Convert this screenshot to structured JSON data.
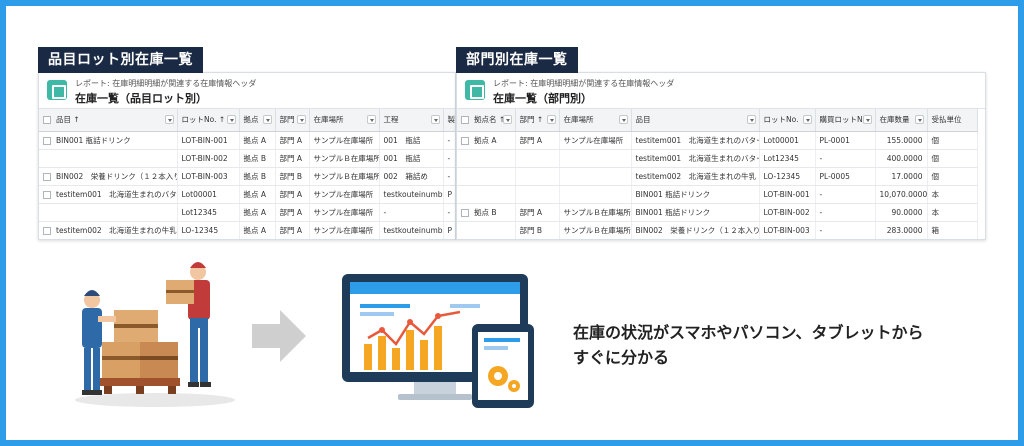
{
  "left_panel": {
    "tag": "品目ロット別在庫一覧",
    "report_subtitle": "レポート: 在庫明細明細が関連する在庫情報ヘッダ",
    "report_title": "在庫一覧（品目ロット別）",
    "columns": [
      "品目 ↑",
      "ロットNo. ↑",
      "拠点",
      "部門",
      "在庫場所",
      "工程",
      "製"
    ],
    "rows": [
      {
        "item": "BIN001 瓶詰ドリンク",
        "lot": "LOT-BIN-001",
        "site": "拠点 A",
        "dept": "部門 A",
        "loc": "サンプル在庫場所",
        "proc": "001　瓶詰",
        "x": "-"
      },
      {
        "item": "",
        "lot": "LOT-BIN-002",
        "site": "拠点 B",
        "dept": "部門 A",
        "loc": "サンプルＢ在庫場所",
        "proc": "001　瓶詰",
        "x": "-"
      },
      {
        "item": "BIN002　栄養ドリンク（１２本入り）",
        "lot": "LOT-BIN-003",
        "site": "拠点 B",
        "dept": "部門 B",
        "loc": "サンプルＢ在庫場所",
        "proc": "002　箱詰め",
        "x": "-"
      },
      {
        "item": "testitem001　北海道生まれのバター",
        "lot": "Lot00001",
        "site": "拠点 A",
        "dept": "部門 A",
        "loc": "サンプル在庫場所",
        "proc": "testkouteinumber",
        "x": "P"
      },
      {
        "item": "",
        "lot": "Lot12345",
        "site": "拠点 A",
        "dept": "部門 A",
        "loc": "サンプル在庫場所",
        "proc": "-",
        "x": "-"
      },
      {
        "item": "testitem002　北海道生まれの牛乳",
        "lot": "LO-12345",
        "site": "拠点 A",
        "dept": "部門 A",
        "loc": "サンプル在庫場所",
        "proc": "testkouteinumber",
        "x": "P"
      }
    ]
  },
  "right_panel": {
    "tag": "部門別在庫一覧",
    "report_subtitle": "レポート: 在庫明細明細が関連する在庫情報ヘッダ",
    "report_title": "在庫一覧（部門別）",
    "columns": [
      "拠点名 ↑",
      "部門 ↑",
      "在庫場所",
      "品目",
      "ロットNo.",
      "購買ロットNo.",
      "在庫数量",
      "受払単位"
    ],
    "rows": [
      {
        "site": "拠点 A",
        "dept": "部門 A",
        "loc": "サンプル在庫場所",
        "item": "testitem001　北海道生まれのバター",
        "lot": "Lot00001",
        "plot": "PL-0001",
        "qty": "155.0000",
        "unit": "個"
      },
      {
        "site": "",
        "dept": "",
        "loc": "",
        "item": "testitem001　北海道生まれのバター",
        "lot": "Lot12345",
        "plot": "-",
        "qty": "400.0000",
        "unit": "個"
      },
      {
        "site": "",
        "dept": "",
        "loc": "",
        "item": "testitem002　北海道生まれの牛乳",
        "lot": "LO-12345",
        "plot": "PL-0005",
        "qty": "17.0000",
        "unit": "個"
      },
      {
        "site": "",
        "dept": "",
        "loc": "",
        "item": "BIN001 瓶詰ドリンク",
        "lot": "LOT-BIN-001",
        "plot": "-",
        "qty": "10,070.0000",
        "unit": "本"
      },
      {
        "site": "拠点 B",
        "dept": "部門 A",
        "loc": "サンプルＢ在庫場所",
        "item": "BIN001 瓶詰ドリンク",
        "lot": "LOT-BIN-002",
        "plot": "-",
        "qty": "90.0000",
        "unit": "本"
      },
      {
        "site": "",
        "dept": "部門 B",
        "loc": "サンプルＢ在庫場所",
        "item": "BIN002　栄養ドリンク（１２本入り）",
        "lot": "LOT-BIN-003",
        "plot": "-",
        "qty": "283.0000",
        "unit": "箱"
      }
    ]
  },
  "caption": {
    "line1": "在庫の状況がスマホやパソコン、タブレットから",
    "line2": "すぐに分かる"
  },
  "colors": {
    "frame": "#2d9ce9",
    "tag_bg": "#1b2a44",
    "link": "#1b6ac9",
    "report_icon": "#3fb8a5"
  }
}
